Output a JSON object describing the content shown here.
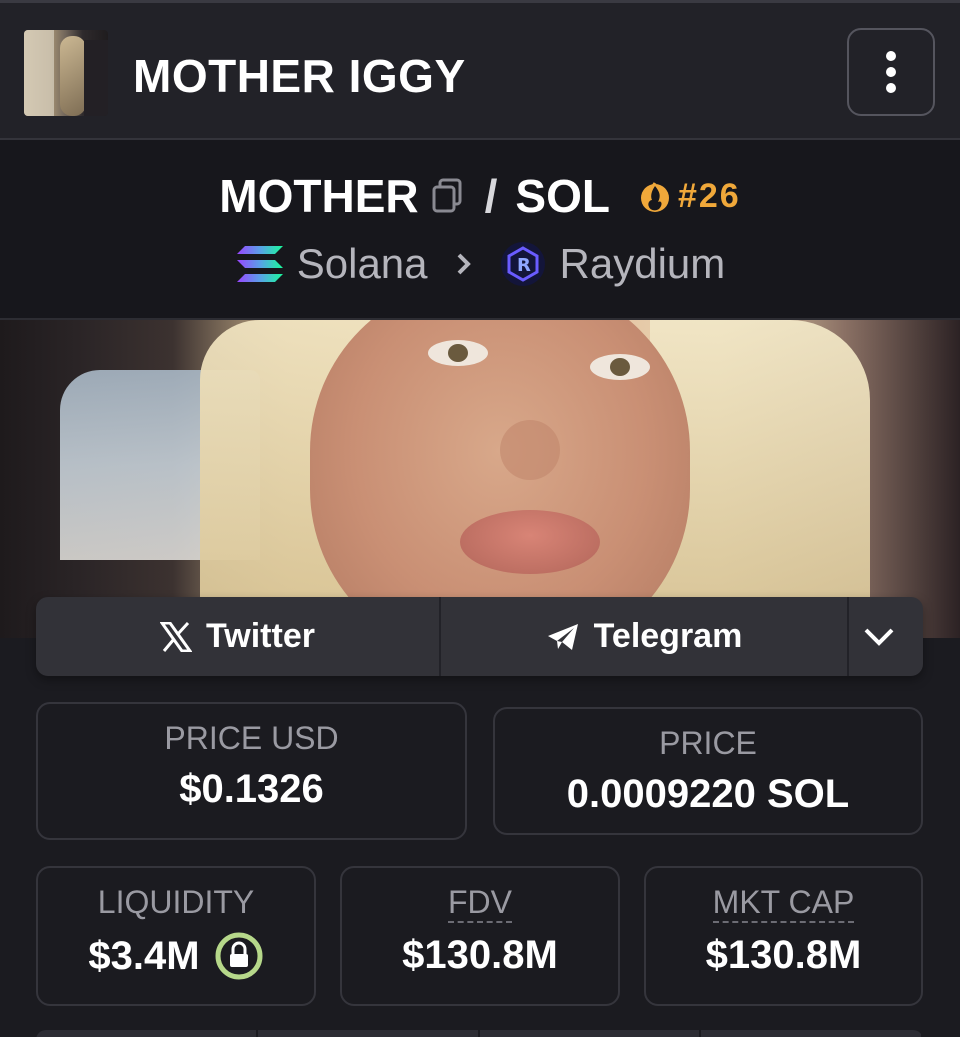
{
  "header": {
    "title": "MOTHER IGGY",
    "menu_icon": "more-vertical-icon"
  },
  "pair": {
    "base": "MOTHER",
    "separator": "/",
    "quote": "SOL",
    "trending_rank": "#26",
    "chain": "Solana",
    "dex": "Raydium",
    "accent_color": "#f0a83a"
  },
  "socials": {
    "twitter_label": "Twitter",
    "telegram_label": "Telegram"
  },
  "stats": {
    "price_usd_label": "PRICE USD",
    "price_usd_value": "$0.1326",
    "price_label": "PRICE",
    "price_value": "0.0009220 SOL",
    "liquidity_label": "LIQUIDITY",
    "liquidity_value": "$3.4M",
    "fdv_label": "FDV",
    "fdv_value": "$130.8M",
    "mktcap_label": "MKT CAP",
    "mktcap_value": "$130.8M"
  }
}
